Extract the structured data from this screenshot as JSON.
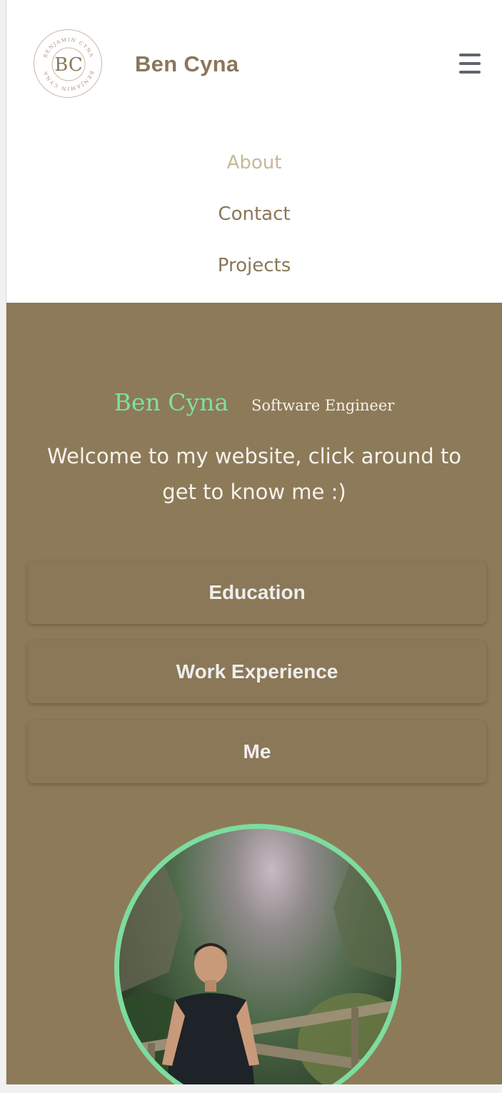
{
  "header": {
    "logo_label": "Benjamin Cyna monogram logo",
    "logo_monogram": "BC",
    "logo_ring_text": "BENJAMIN CYNA",
    "brand": "Ben Cyna",
    "menu_icon": "hamburger-menu-icon"
  },
  "nav": {
    "items": [
      {
        "label": "About",
        "active": true
      },
      {
        "label": "Contact",
        "active": false
      },
      {
        "label": "Projects",
        "active": false
      }
    ]
  },
  "hero": {
    "name": "Ben Cyna",
    "role": "Software Engineer",
    "welcome": "Welcome to my website, click around to get to know me :)",
    "buttons": [
      {
        "label": "Education"
      },
      {
        "label": "Work Experience"
      },
      {
        "label": "Me"
      }
    ],
    "photo_alt": "Portrait of Ben Cyna standing on a wooden bridge in a green canyon"
  },
  "colors": {
    "brand_text": "#8b7659",
    "nav_active": "#c8b89a",
    "hero_bg": "#8d7a59",
    "accent_green": "#7ee0a2",
    "button_text": "#eeeeee"
  }
}
